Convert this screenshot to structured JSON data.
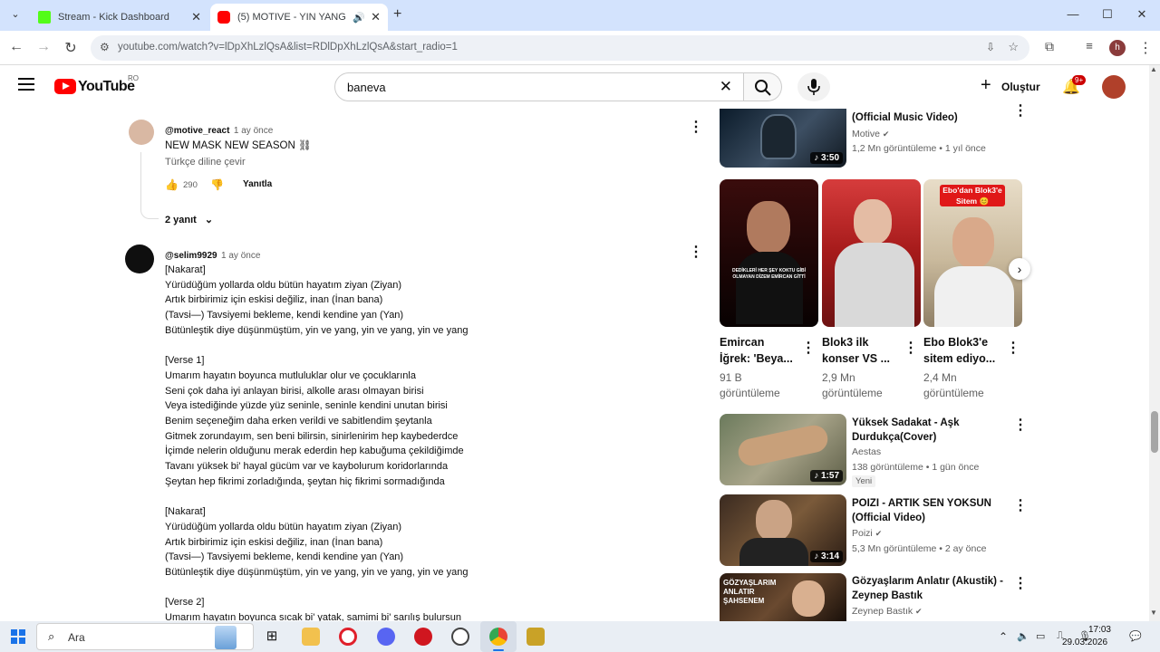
{
  "browser": {
    "tabs": [
      {
        "title": "Stream - Kick Dashboard",
        "active": false
      },
      {
        "title": "(5) MOTIVE - YIN YANG (C",
        "active": true
      }
    ],
    "url": "youtube.com/watch?v=lDpXhLzlQsA&list=RDlDpXhLzlQsA&start_radio=1"
  },
  "youtube": {
    "logo": "YouTube",
    "region": "RO",
    "search_value": "baneva",
    "create_label": "Oluştur",
    "notif_badge": "9+"
  },
  "comments": [
    {
      "author": "@motive_react",
      "time": "1 ay önce",
      "text": "NEW MASK NEW SEASON ⛓",
      "translate": "Türkçe diline çevir",
      "likes": "290",
      "reply_label": "Yanıtla",
      "replies_label": "2 yanıt"
    },
    {
      "author": "@selim9929",
      "time": "1 ay önce",
      "lines": [
        "[Nakarat]",
        "Yürüdüğüm yollarda oldu bütün hayatım ziyan (Ziyan)",
        "Artık birbirimiz için eskisi değiliz, inan (İnan bana)",
        "(Tavsi—) Tavsiyemi bekleme, kendi kendine yan (Yan)",
        "Bütünleştik diye düşünmüştüm, yin ve yang, yin ve yang, yin ve yang",
        "",
        "[Verse 1]",
        "Umarım hayatın boyunca mutluluklar olur ve çocuklarınla",
        "Seni çok daha iyi anlayan birisi, alkolle arası olmayan birisi",
        "Veya istediğinde yüzde yüz seninle, seninle kendini unutan birisi",
        "Benim seçeneğim daha erken verildi ve sabitlendim şeytanla",
        "Gitmek zorundayım, sen beni bilirsin, sinirlenirim hep kaybederdce",
        "İçimde nelerin olduğunu merak ederdin hep kabuğuma çekildiğimde",
        "Tavanı yüksek bi' hayal gücüm var ve kaybolurum koridorlarında",
        "Şeytan hep fikrimi zorladığında, şeytan hiç fikrimi sormadığında",
        "",
        "[Nakarat]",
        "Yürüdüğüm yollarda oldu bütün hayatım ziyan (Ziyan)",
        "Artık birbirimiz için eskisi değiliz, inan (İnan bana)",
        "(Tavsi—) Tavsiyemi bekleme, kendi kendine yan (Yan)",
        "Bütünleştik diye düşünmüştüm, yin ve yang, yin ve yang, yin ve yang",
        "",
        "[Verse 2]",
        "Umarım hayatın boyunca sıcak bi' yatak, samimi bi' sarılış bulursun"
      ]
    }
  ],
  "sidebar": {
    "top_video": {
      "title": "(Official Music Video)",
      "channel": "Motive",
      "meta": "1,2 Mn görüntüleme • 1 yıl önce",
      "duration": "3:50"
    },
    "shorts": [
      {
        "title": "Emircan İğrek: 'Beya...",
        "views": "91 B",
        "views_label": "görüntüleme",
        "overlay": "DEDİKLERİ HER ŞEY KOKTU GİBİ OLMAYAN DİZEM EMİRCAN GİTTİ"
      },
      {
        "title": "Blok3 ilk konser VS ...",
        "views": "2,9 Mn",
        "views_label": "görüntüleme",
        "overlay": ""
      },
      {
        "title": "Ebo Blok3'e sitem ediyo...",
        "views": "2,4 Mn",
        "views_label": "görüntüleme",
        "overlay": "Ebo'dan Blok3'e Sitem 😊"
      }
    ],
    "videos": [
      {
        "title": "Yüksek Sadakat - Aşk Durdukça(Cover)",
        "channel": "Aestas",
        "meta": "138 görüntüleme • 1 gün önce",
        "badge": "Yeni",
        "duration": "1:57"
      },
      {
        "title": "POIZI - ARTIK SEN YOKSUN (Official Video)",
        "channel": "Poizi",
        "meta": "5,3 Mn görüntüleme • 2 ay önce",
        "badge": "",
        "duration": "3:14"
      },
      {
        "title": "Gözyaşlarım Anlatır (Akustik) - Zeynep Bastık",
        "channel": "Zeynep Bastık",
        "meta": "",
        "badge": "",
        "duration": "",
        "overlay": "GÖZYAŞLARIM ANLATIR ŞAHSENEM"
      }
    ]
  },
  "taskbar": {
    "search_label": "Ara",
    "time": "17:03",
    "date": "29.03.2026"
  }
}
